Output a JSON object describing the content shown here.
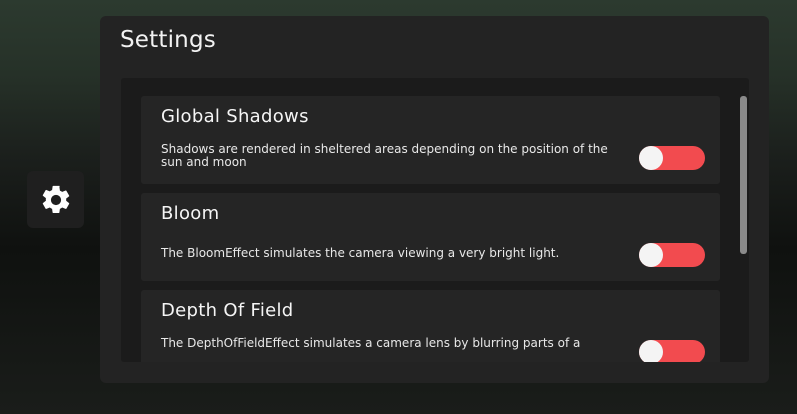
{
  "gear_button": {
    "icon": "gear-icon"
  },
  "panel": {
    "title": "Settings",
    "settings": [
      {
        "title": "Global Shadows",
        "description": "Shadows are rendered in sheltered areas depending on the position of the sun and moon",
        "enabled": false
      },
      {
        "title": "Bloom",
        "description": "The BloomEffect simulates the camera viewing a very bright light.",
        "enabled": false
      },
      {
        "title": "Depth Of Field",
        "description": "The DepthOfFieldEffect simulates a camera lens by blurring parts of a",
        "enabled": false
      }
    ]
  },
  "colors": {
    "toggle_off": "#f24b4f",
    "panel_bg": "#232323",
    "card_bg": "#252525"
  }
}
